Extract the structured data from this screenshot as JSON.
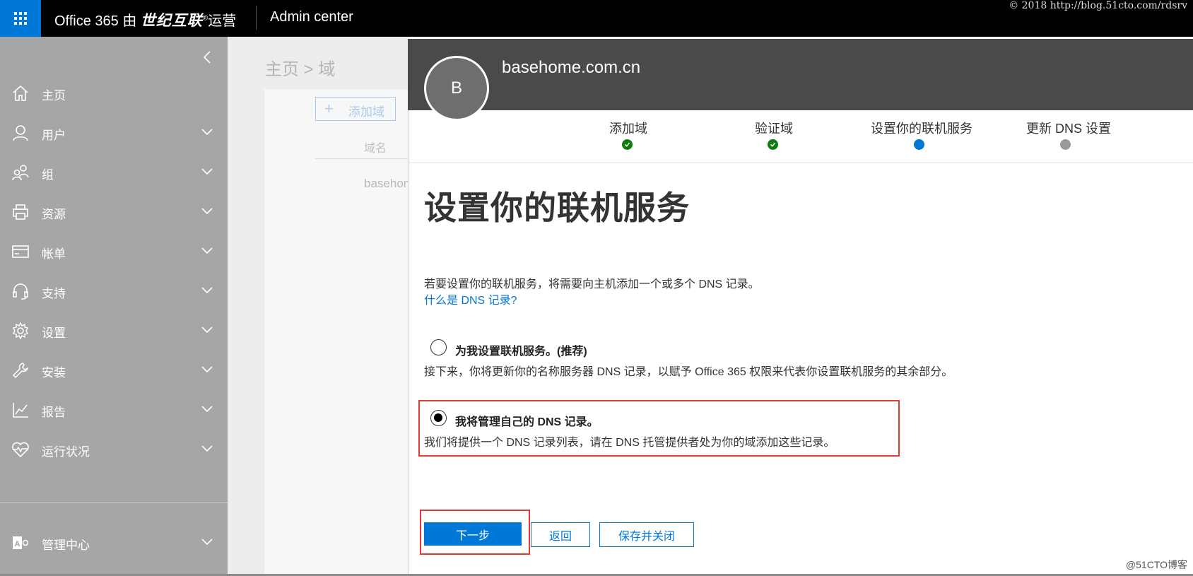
{
  "header": {
    "brand_prefix": "Office 365 由",
    "brand_bold": "世纪互联",
    "brand_reg": "®",
    "brand_suffix": "运营",
    "app_name": "Admin center",
    "watermark": "© 2018 http://blog.51cto.com/rdsrv"
  },
  "sidebar": {
    "items": [
      {
        "label": "主页",
        "icon": "home-icon",
        "expandable": false
      },
      {
        "label": "用户",
        "icon": "user-icon",
        "expandable": true
      },
      {
        "label": "组",
        "icon": "group-icon",
        "expandable": true
      },
      {
        "label": "资源",
        "icon": "printer-icon",
        "expandable": true
      },
      {
        "label": "帐单",
        "icon": "credit-card-icon",
        "expandable": true
      },
      {
        "label": "支持",
        "icon": "headset-icon",
        "expandable": true
      },
      {
        "label": "设置",
        "icon": "gear-icon",
        "expandable": true
      },
      {
        "label": "安装",
        "icon": "wrench-icon",
        "expandable": true
      },
      {
        "label": "报告",
        "icon": "chart-icon",
        "expandable": true
      },
      {
        "label": "运行状况",
        "icon": "heart-pulse-icon",
        "expandable": true
      },
      {
        "label": "管理中心",
        "icon": "admin-centers-icon",
        "expandable": true
      }
    ]
  },
  "background": {
    "breadcrumb": "主页 > 域",
    "add_domain": "添加域",
    "column_domain": "域名",
    "row_domain": "basehome.com.cn"
  },
  "panel": {
    "avatar_letter": "B",
    "domain": "basehome.com.cn",
    "steps": [
      {
        "label": "添加域",
        "status": "done"
      },
      {
        "label": "验证域",
        "status": "done"
      },
      {
        "label": "设置你的联机服务",
        "status": "current"
      },
      {
        "label": "更新 DNS 设置",
        "status": "todo"
      }
    ],
    "title": "设置你的联机服务",
    "intro": "若要设置你的联机服务，将需要向主机添加一个或多个 DNS 记录。",
    "intro_link": "什么是 DNS 记录?",
    "option1": {
      "label": "为我设置联机服务。(推荐)",
      "desc": "接下来，你将更新你的名称服务器 DNS 记录，以赋予 Office 365 权限来代表你设置联机服务的其余部分。",
      "selected": false
    },
    "option2": {
      "label": "我将管理自己的 DNS 记录。",
      "desc": "我们将提供一个 DNS 记录列表，请在 DNS 托管提供者处为你的域添加这些记录。",
      "selected": true
    },
    "buttons": {
      "next": "下一步",
      "back": "返回",
      "save_close": "保存并关闭"
    }
  },
  "corner_mark": "@51CTO博客",
  "colors": {
    "accent": "#0078d7",
    "done": "#107c10",
    "highlight": "#e53935",
    "nav_bg": "#a6a6a6"
  }
}
